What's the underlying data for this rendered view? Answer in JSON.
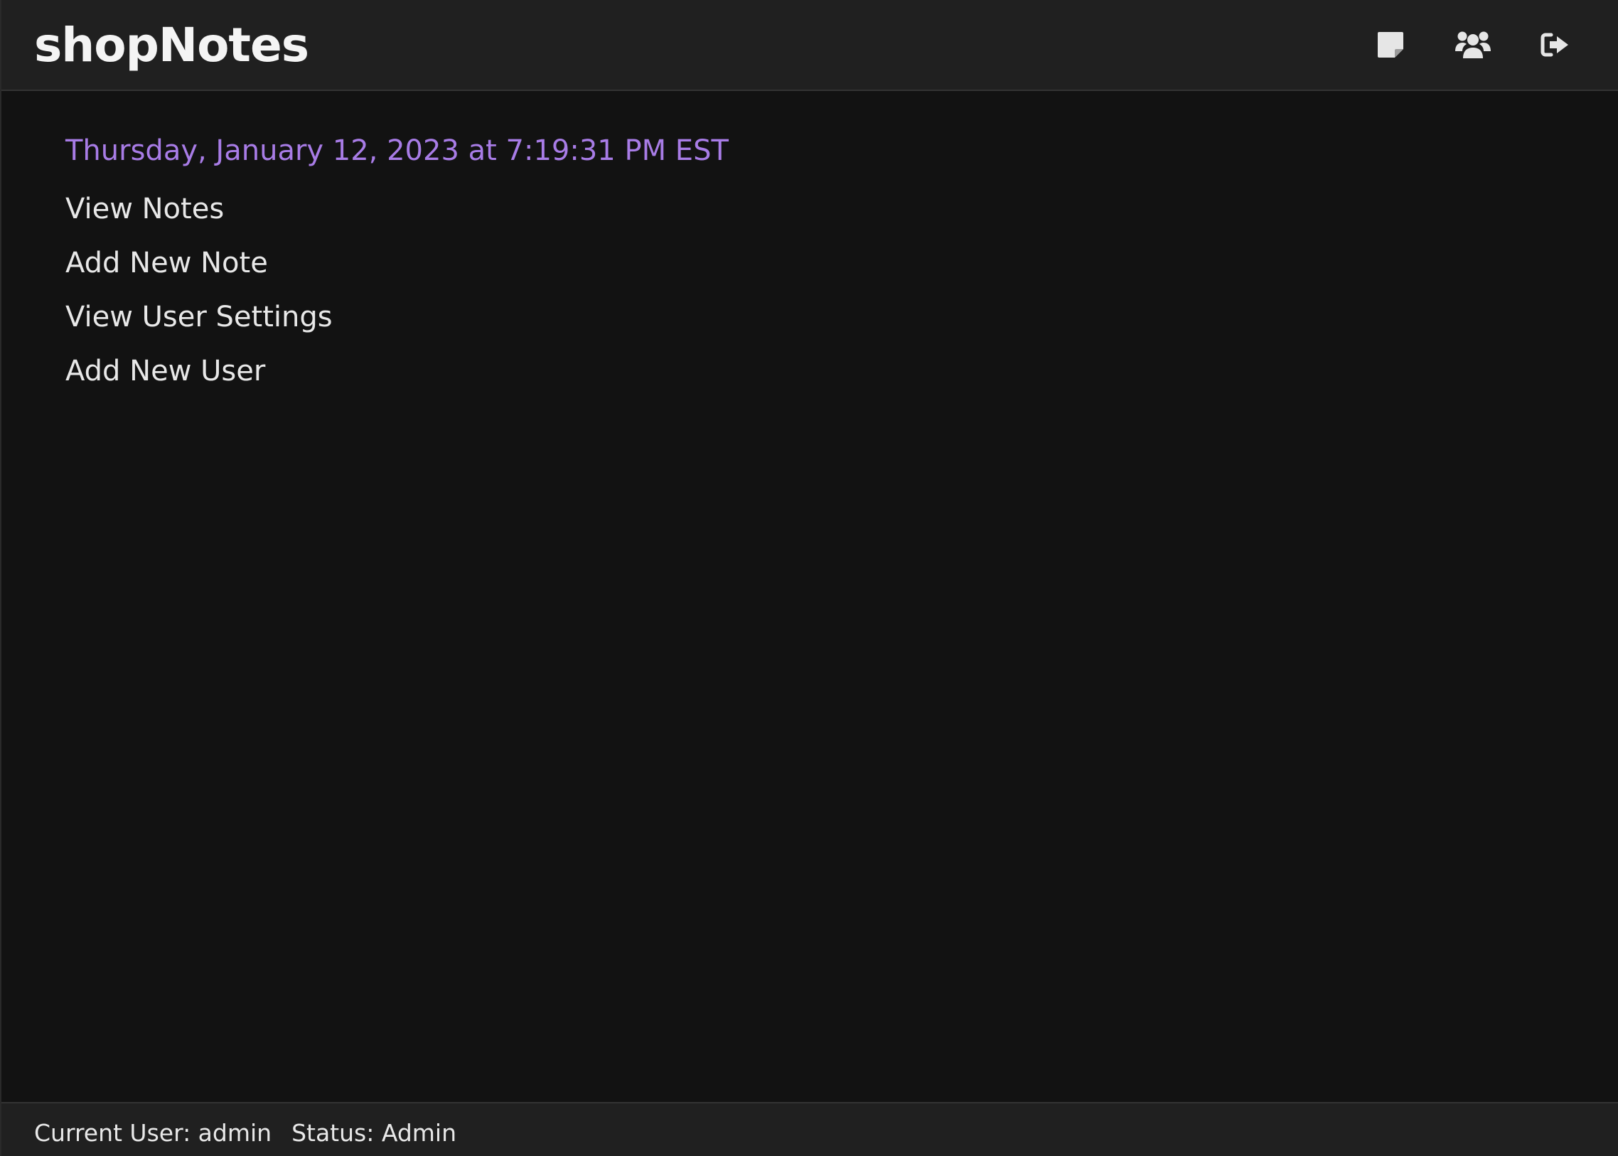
{
  "app": {
    "brand": "shopNotes"
  },
  "header": {
    "icons": [
      {
        "name": "note-icon"
      },
      {
        "name": "users-icon"
      },
      {
        "name": "logout-icon"
      }
    ]
  },
  "main": {
    "datetime": "Thursday, January 12, 2023 at 7:19:31 PM EST",
    "menu": [
      "View Notes",
      "Add New Note",
      "View User Settings",
      "Add New User"
    ]
  },
  "footer": {
    "current_user": "Current User: admin",
    "status": "Status: Admin"
  },
  "colors": {
    "background": "#121212",
    "header_bg": "#202020",
    "accent": "#a87ce6",
    "text": "#e8e8e8"
  }
}
